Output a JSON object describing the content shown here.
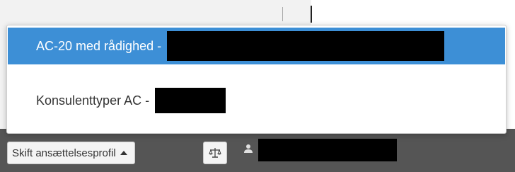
{
  "dropdown": {
    "items": [
      {
        "label": "AC-20 med rådighed -",
        "selected": true
      },
      {
        "label": "Konsulenttyper AC -",
        "selected": false
      }
    ]
  },
  "toolbar": {
    "profile_button_label": "Skift ansættelsesprofil",
    "icons": [
      "caret-up-icon",
      "balance-scale-icon",
      "user-icon"
    ]
  },
  "colors": {
    "selected_bg": "#3d8fd6",
    "toolbar_bg": "#555555",
    "text": "#333333"
  }
}
